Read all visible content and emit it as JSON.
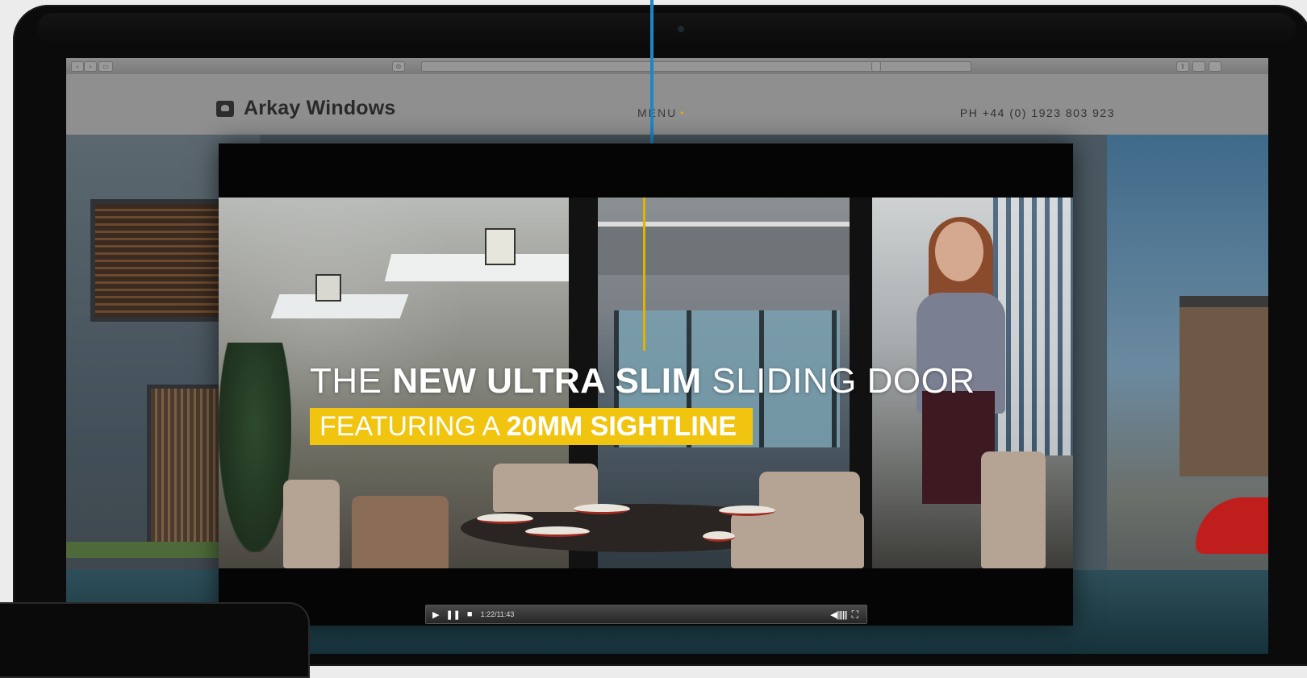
{
  "site": {
    "logo_text": "Arkay Windows",
    "menu_label": "MENU",
    "menu_dot": "•",
    "phone": "PH +44 (0) 1923 803 923"
  },
  "browser": {
    "back": "‹",
    "forward": "›",
    "sidebar": "▭",
    "share": "⇪",
    "reader": "⊙"
  },
  "video": {
    "headline_pre": "THE ",
    "headline_bold": "NEW ULTRA SLIM",
    "headline_post": " SLIDING DOOR",
    "subline_pre": "FEATURING A ",
    "subline_bold": "20MM SIGHTLINE",
    "time": "1:22/11:43",
    "play_icon": "▶",
    "pause_icon": "❚❚",
    "stop_icon": "■",
    "volume_icon": "◀|||||||",
    "fullscreen_icon": "⛶"
  },
  "colors": {
    "accent": "#f1c40f",
    "cable": "#1e86c5",
    "header_bg": "#8f8f8f"
  }
}
